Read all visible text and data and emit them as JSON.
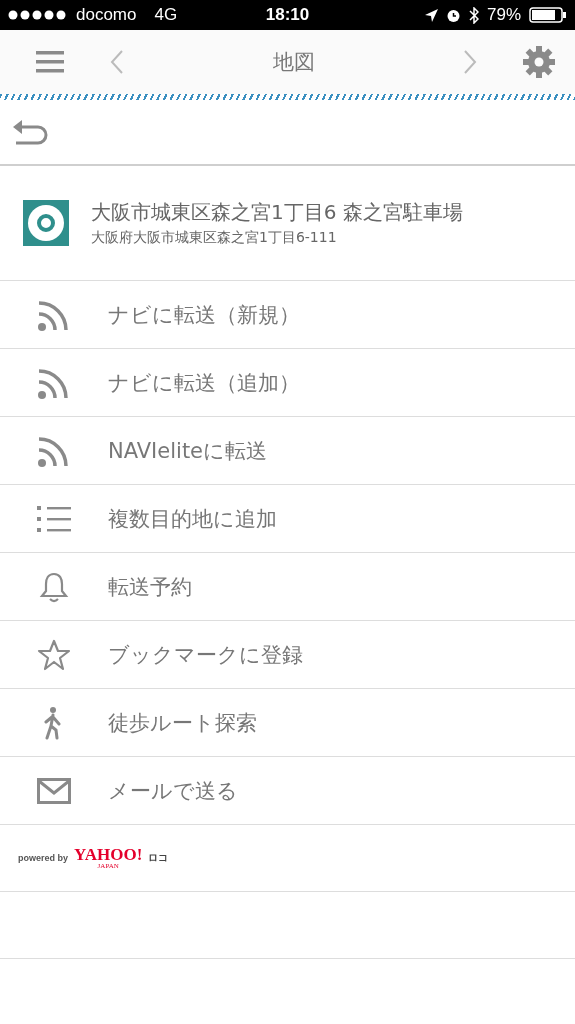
{
  "status_bar": {
    "carrier": "docomo",
    "network": "4G",
    "time": "18:10",
    "battery": "79%"
  },
  "header": {
    "title": "地図"
  },
  "place": {
    "name": "大阪市城東区森之宮1丁目6 森之宮駐車場",
    "address": "大阪府大阪市城東区森之宮1丁目6-111"
  },
  "menu": [
    {
      "kind": "feed",
      "label": "ナビに転送（新規）"
    },
    {
      "kind": "feed",
      "label": "ナビに転送（追加）"
    },
    {
      "kind": "feed",
      "label": "NAVIeliteに転送"
    },
    {
      "kind": "list",
      "label": "複数目的地に追加"
    },
    {
      "kind": "bell",
      "label": "転送予約"
    },
    {
      "kind": "star",
      "label": "ブックマークに登録"
    },
    {
      "kind": "walk",
      "label": "徒歩ルート探索"
    },
    {
      "kind": "mail",
      "label": "メールで送る"
    }
  ],
  "credit": {
    "prefix": "powered by",
    "brand": "YAHOO!",
    "region": "JAPAN",
    "service": "ロコ"
  }
}
